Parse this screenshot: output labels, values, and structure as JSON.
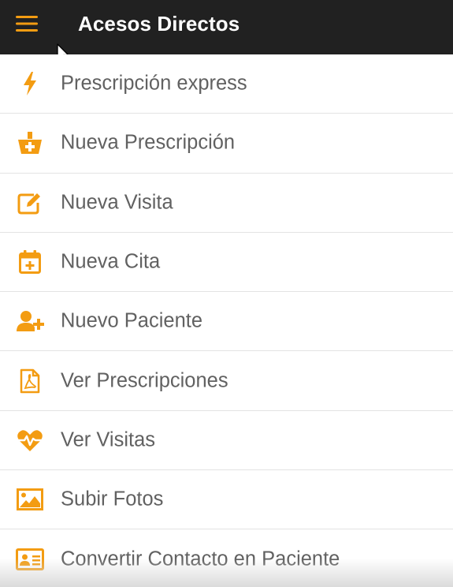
{
  "colors": {
    "accent": "#F39C12",
    "toolbar": "#212121",
    "text": "#616161",
    "divider": "#E3E3E3"
  },
  "header": {
    "title": "Acesos Directos",
    "menu_icon": "hamburger-menu-icon"
  },
  "shortcuts": [
    {
      "label": "Prescripción express",
      "icon": "lightning-bolt-icon"
    },
    {
      "label": "Nueva Prescripción",
      "icon": "medical-basket-icon"
    },
    {
      "label": "Nueva Visita",
      "icon": "edit-note-icon"
    },
    {
      "label": "Nueva Cita",
      "icon": "calendar-plus-icon"
    },
    {
      "label": "Nuevo Paciente",
      "icon": "add-user-icon"
    },
    {
      "label": "Ver Prescripciones",
      "icon": "pdf-document-icon"
    },
    {
      "label": "Ver Visitas",
      "icon": "heartbeat-icon"
    },
    {
      "label": "Subir Fotos",
      "icon": "image-icon"
    },
    {
      "label": "Convertir Contacto en Paciente",
      "icon": "contact-card-icon"
    }
  ]
}
